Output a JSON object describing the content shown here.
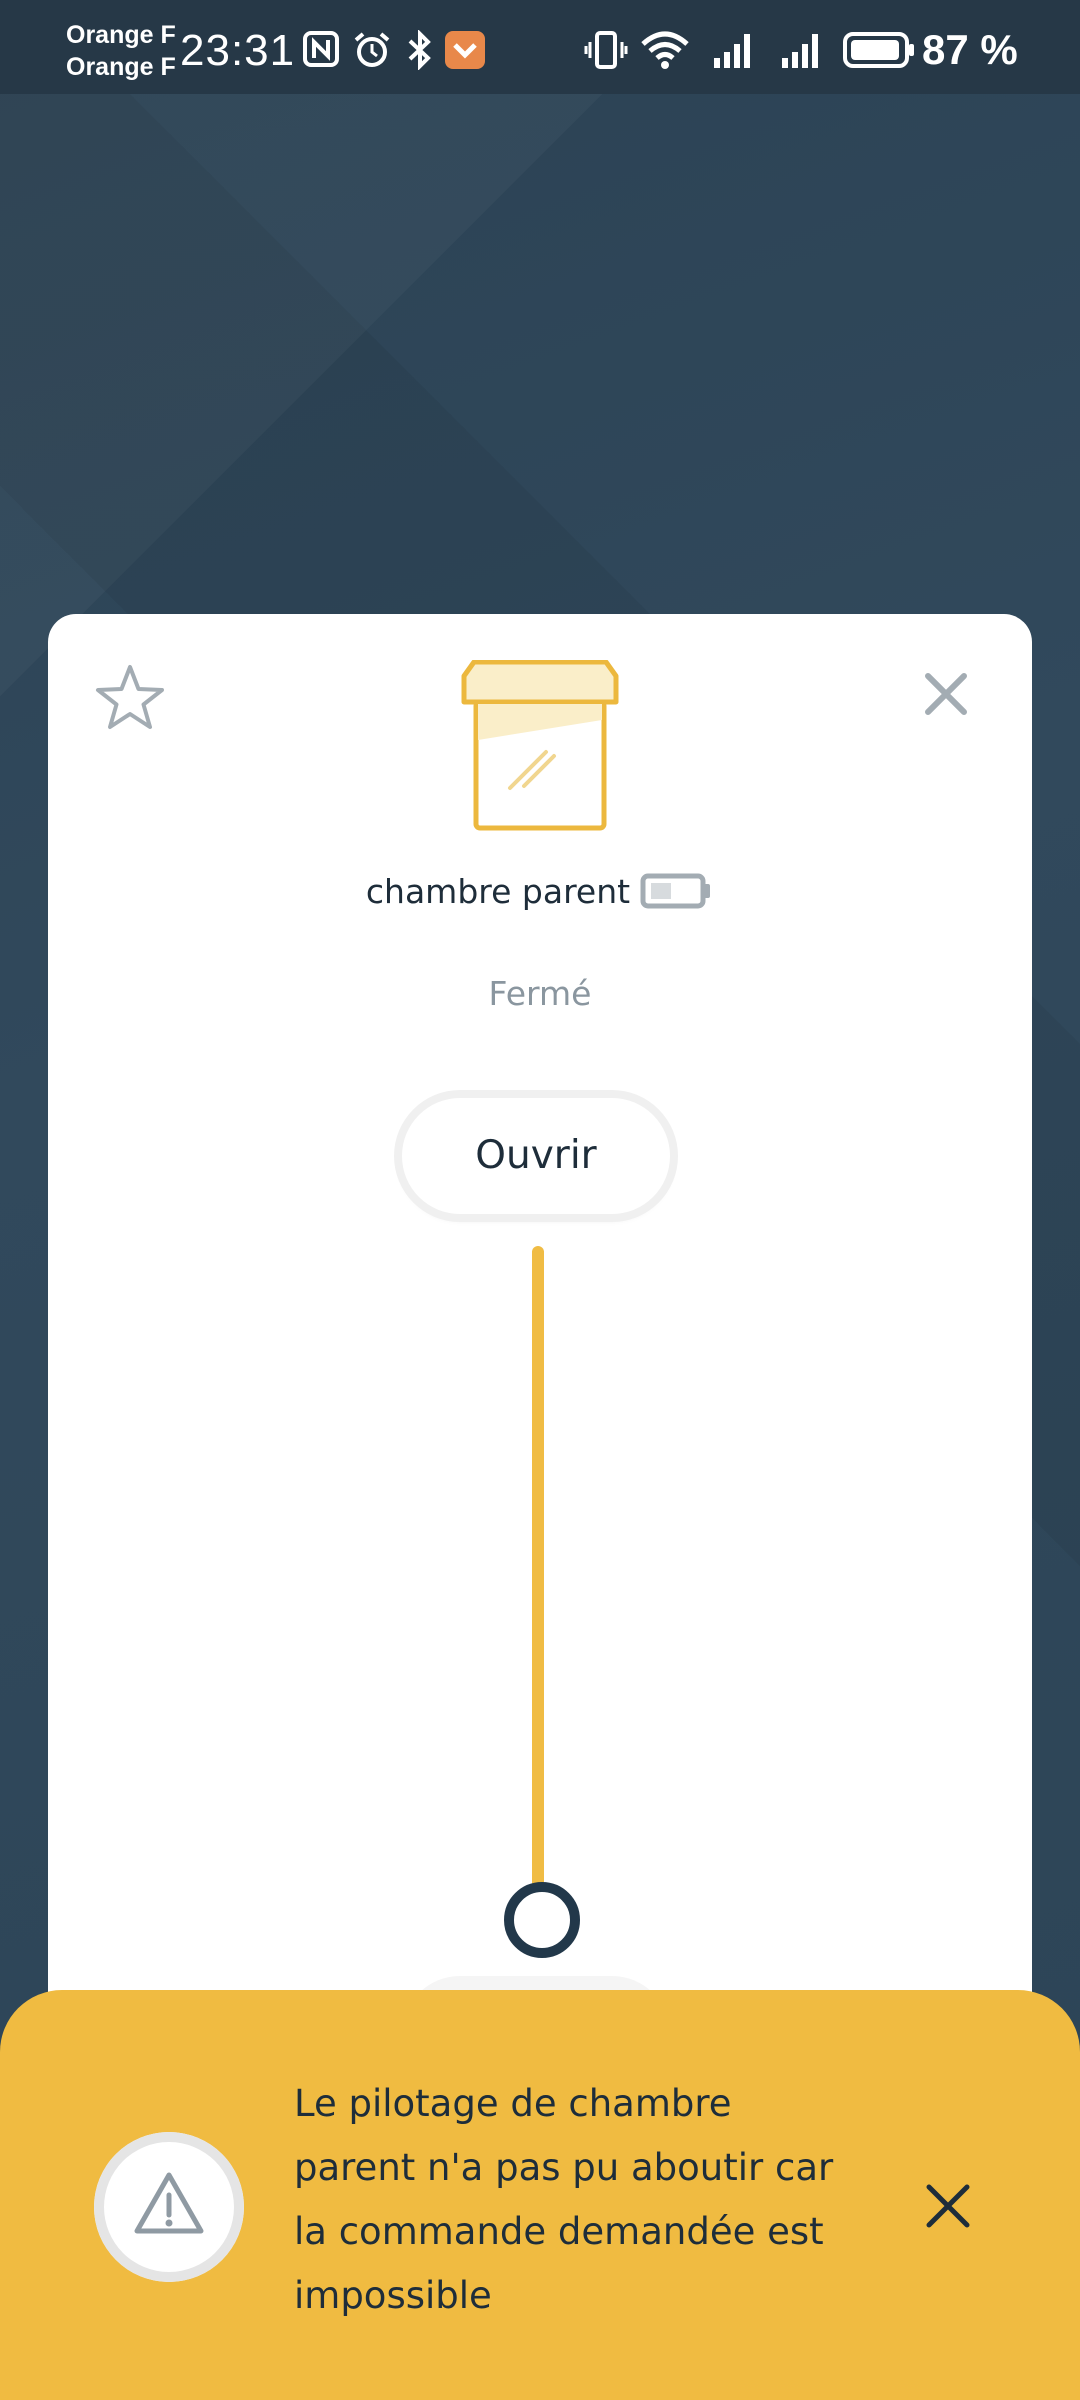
{
  "status_bar": {
    "carrier_1": "Orange F",
    "carrier_2": "Orange F",
    "time": "23:31",
    "battery": "87 %",
    "icons": [
      "nfc-icon",
      "alarm-icon",
      "bluetooth-icon",
      "app-notification-icon",
      "vibrate-icon",
      "wifi-icon",
      "signal-icon",
      "signal-icon",
      "battery-icon"
    ]
  },
  "card": {
    "favorite_icon": "star-icon",
    "close_icon": "close-icon",
    "device_icon": "window-icon",
    "device_name": "chambre parent",
    "battery_icon": "battery-low-icon",
    "state": "Fermé",
    "open_button": "Ouvrir",
    "slider": {
      "value": 0.0
    }
  },
  "toast": {
    "icon": "warning-icon",
    "message": "Le pilotage de chambre parent n'a pas pu aboutir car la commande demandée est impossible",
    "close_icon": "close-icon"
  },
  "colors": {
    "accent": "#f0bb41",
    "dark": "#22384a",
    "background": "#2e4658"
  }
}
